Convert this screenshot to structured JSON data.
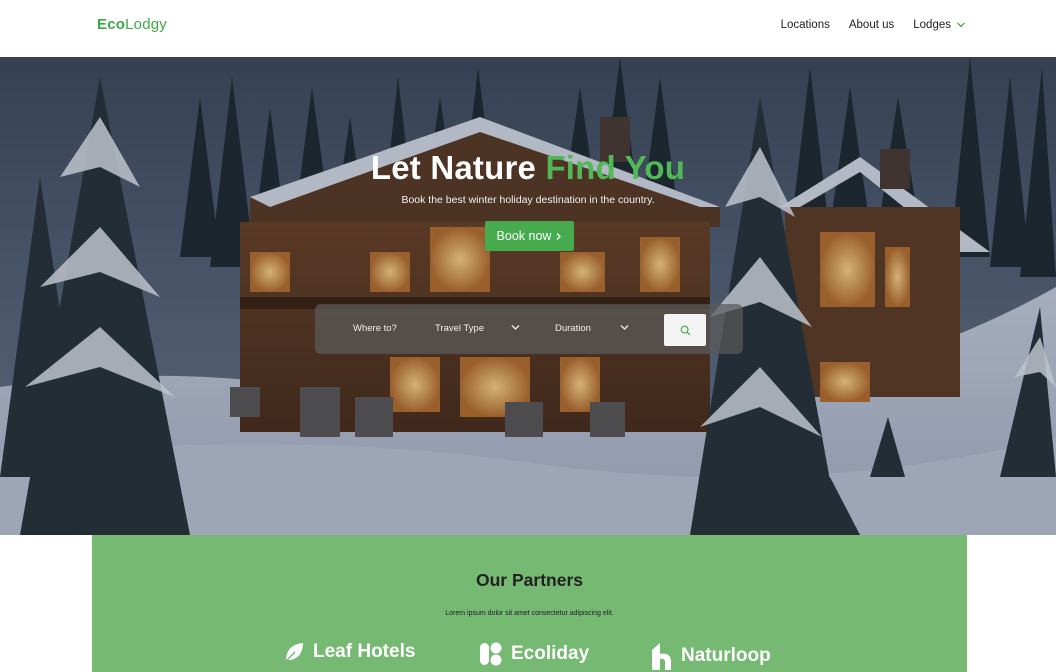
{
  "brand": {
    "logo_bold": "Eco",
    "logo_rest": "Lodgy",
    "accent_color": "#46ab4d"
  },
  "nav": {
    "items": [
      {
        "label": "Locations"
      },
      {
        "label": "About us"
      },
      {
        "label": "Lodges",
        "icon": "chevron-down-icon"
      }
    ]
  },
  "hero": {
    "title_main": "Let Nature ",
    "title_accent": "Find You",
    "subtitle": "Book the best winter holiday destination in the country.",
    "cta_label": "Book now",
    "cta_icon": "chevron-right-icon"
  },
  "search": {
    "where_label": "Where to?",
    "travel_type_label": "Travel Type",
    "duration_label": "Duration",
    "button_icon": "search-icon"
  },
  "partners": {
    "title": "Our Partners",
    "subtitle": "Lorem ipsum dolor sit amet consectetur adipiscing elit.",
    "background_color": "#75b972",
    "items": [
      {
        "name": "Leaf Hotels",
        "icon": "leaf-icon"
      },
      {
        "name": "Ecoliday",
        "icon": "ecoliday-logo-icon"
      },
      {
        "name": "Naturloop",
        "icon": "naturloop-logo-icon"
      }
    ]
  }
}
